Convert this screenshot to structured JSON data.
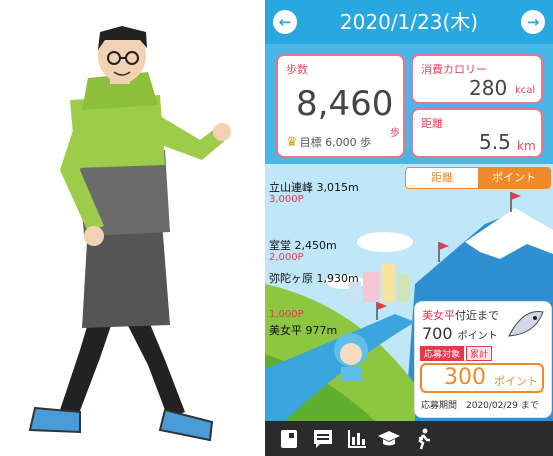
{
  "header": {
    "date": "2020/1/23(木)"
  },
  "stats": {
    "steps": {
      "label": "歩数",
      "value": "8,460",
      "unit": "歩",
      "goal": "目標 6,000 歩"
    },
    "calories": {
      "label": "消費カロリー",
      "value": "280",
      "unit": "kcal"
    },
    "distance": {
      "label": "距離",
      "value": "5.5",
      "unit": "km"
    }
  },
  "toggle": {
    "distance": "距離",
    "points": "ポイント"
  },
  "milestones": [
    {
      "name": "立山連峰 3,015m",
      "points": "3,000P"
    },
    {
      "name": "室堂 2,450m",
      "points": "2,000P"
    },
    {
      "name": "弥陀ヶ原 1,930m"
    },
    {
      "name": "美女平 977m",
      "points": "1,000P"
    }
  ],
  "info_card": {
    "place": "美女平",
    "title_rest": "付近まで",
    "points": "700",
    "points_unit": "ポイント",
    "tag_apply": "応募対象",
    "tag_total": "累計",
    "total": "300",
    "total_unit": "ポイント",
    "period": "応募期間　2020/02/29 まで"
  },
  "colors": {
    "primary": "#29a7e1",
    "accent": "#ef8a2a",
    "pink": "#e5394e"
  },
  "bottom_nav": [
    "notebook-icon",
    "memo-icon",
    "chart-icon",
    "graduation-cap-icon",
    "walking-icon"
  ]
}
